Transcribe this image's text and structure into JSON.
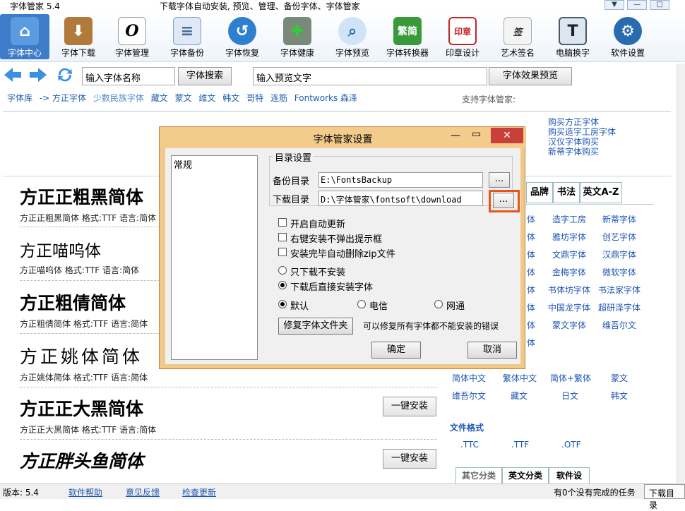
{
  "window": {
    "app_title": "字体管家 5.4",
    "caption": "下载字体自动安装, 预览、管理、备份字体、字体管家"
  },
  "toolbar": [
    {
      "label": "字体中心",
      "icon": "home-icon",
      "color": "#3d7cc9"
    },
    {
      "label": "字体下载",
      "icon": "download-box-icon",
      "color": "#b07a3a"
    },
    {
      "label": "字体管理",
      "icon": "font-o-icon",
      "color": "#ffffff"
    },
    {
      "label": "字体备份",
      "icon": "document-icon",
      "color": "#8aa8d0"
    },
    {
      "label": "字体恢复",
      "icon": "restore-icon",
      "color": "#2f7fcf"
    },
    {
      "label": "字体健康",
      "icon": "medkit-icon",
      "color": "#6a8a6a"
    },
    {
      "label": "字体预览",
      "icon": "magnifier-icon",
      "color": "#5aa0e0"
    },
    {
      "label": "字体转换器",
      "icon": "converter-icon",
      "color": "#3a9a3a"
    },
    {
      "label": "印章设计",
      "icon": "seal-icon",
      "color": "#c02828"
    },
    {
      "label": "艺术签名",
      "icon": "signature-icon",
      "color": "#ffffff"
    },
    {
      "label": "电脑换字",
      "icon": "monitor-icon",
      "color": "#6a8aa8"
    },
    {
      "label": "软件设置",
      "icon": "gear-icon",
      "color": "#2a6ab0"
    }
  ],
  "search": {
    "font_name_placeholder": "输入字体名称",
    "search_button": "字体搜索",
    "preview_placeholder": "输入预览文字",
    "preview_button": "字体效果预览"
  },
  "breadcrumb": [
    "字体库",
    "-> 方正字体",
    "少数民族字体",
    "藏文",
    "蒙文",
    "维文",
    "韩文",
    "哥特",
    "连筋",
    "Fontworks 森泽"
  ],
  "support_label": "支持字体管家:",
  "buy_links": [
    "购买方正字体",
    "购买造字工房字体",
    "汉仪字体购买",
    "新蒂字体购买"
  ],
  "fonts": [
    {
      "display": "方正正粗黑简体",
      "meta": "方正正粗黑简体  格式:TTF 语言:简体"
    },
    {
      "display": "方正喵呜体",
      "meta": "方正喵呜体  格式:TTF 语言:简体"
    },
    {
      "display": "方正粗倩简体",
      "meta": "方正粗倩简体  格式:TTF 语言:简体"
    },
    {
      "display": "方正姚体简体",
      "meta": "方正姚体简体  格式:TTF 语言:简体"
    },
    {
      "display": "方正正大黑简体",
      "meta": "方正正大黑简体  格式:TTF 语言:简体"
    },
    {
      "display": "方正胖头鱼简体",
      "meta": ""
    }
  ],
  "install_button": "一键安装",
  "right_panel": {
    "tabs": [
      "品牌",
      "书法",
      "英文A-Z"
    ],
    "links": [
      [
        "体",
        "造字工房",
        "新蒂字体"
      ],
      [
        "体",
        "雅坊字体",
        "创艺字体"
      ],
      [
        "体",
        "文鼎字体",
        "汉鼎字体"
      ],
      [
        "体",
        "金梅字体",
        "微软字体"
      ],
      [
        "体",
        "书体坊字体",
        "书法家字体"
      ],
      [
        "体",
        "中国龙字体",
        "超研泽字体"
      ],
      [
        "体",
        "蒙文字体",
        "维吾尔文"
      ],
      [
        "体",
        "",
        ""
      ]
    ],
    "lang_row1": [
      "简体中文",
      "繁体中文",
      "简体+繁体",
      "蒙文"
    ],
    "lang_row2": [
      "维吾尔文",
      "藏文",
      "日文",
      "韩文"
    ],
    "file_format_label": "文件格式",
    "formats": [
      ".TTC",
      ".TTF",
      ".OTF"
    ],
    "bottom_tabs": [
      "其它分类",
      "英文分类",
      "软件设"
    ]
  },
  "dialog": {
    "title": "字体管家设置",
    "list_items": [
      "常规"
    ],
    "group_title": "目录设置",
    "backup_label": "备份目录",
    "backup_path": "E:\\FontsBackup",
    "download_label": "下载目录",
    "download_path": "D:\\字体管家\\fontsoft\\download",
    "browse": "...",
    "checkboxes": [
      {
        "label": "开启自动更新",
        "checked": false
      },
      {
        "label": "右键安装不弹出提示框",
        "checked": false
      },
      {
        "label": "安装完毕自动删除zip文件",
        "checked": false
      }
    ],
    "install_mode": [
      {
        "label": "只下载不安装",
        "selected": false
      },
      {
        "label": "下载后直接安装字体",
        "selected": true
      }
    ],
    "network": [
      {
        "label": "默认",
        "selected": true
      },
      {
        "label": "电信",
        "selected": false
      },
      {
        "label": "网通",
        "selected": false
      }
    ],
    "repair_button": "修复字体文件夹",
    "repair_hint": "可以修复所有字体都不能安装的错误",
    "ok": "确定",
    "cancel": "取消"
  },
  "status": {
    "version": "版本: 5.4",
    "help": "软件帮助",
    "feedback": "意见反馈",
    "update": "检查更新",
    "tasks": "有0个没有完成的任务",
    "download_dir": "下载目录"
  }
}
